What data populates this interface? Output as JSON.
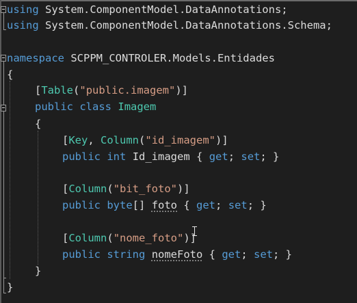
{
  "code": {
    "lines": [
      {
        "k1": "using",
        "rest": " System.ComponentModel.DataAnnotations;"
      },
      {
        "k1": "using",
        "rest": " System.ComponentModel.DataAnnotations.Schema;"
      },
      {
        "k1": "namespace",
        "rest": " SCPPM_CONTROLER.Models.Entidades"
      },
      {
        "brace": "{"
      },
      {
        "attr_open": "[",
        "attr_name": "Table",
        "paren_open": "(",
        "str": "\"public.imagem\"",
        "paren_close": ")]"
      },
      {
        "kw1": "public",
        "kw2": "class",
        "type": "Imagem"
      },
      {
        "brace": "{"
      },
      {
        "attr_open": "[",
        "attr_name": "Key",
        "sep": ", ",
        "attr_name2": "Column",
        "paren_open": "(",
        "str": "\"id_imagem\"",
        "paren_close": ")]"
      },
      {
        "kw1": "public",
        "kw2": "int",
        "name": "Id_imagem",
        "acc_open": " { ",
        "get": "get",
        "semi1": "; ",
        "set": "set",
        "acc_close": "; }"
      },
      {
        "attr_open": "[",
        "attr_name": "Column",
        "paren_open": "(",
        "str": "\"bit_foto\"",
        "paren_close": ")]"
      },
      {
        "kw1": "public",
        "kw2": "byte",
        "arr": "[]",
        "name": "foto",
        "acc_open": " { ",
        "get": "get",
        "semi1": "; ",
        "set": "set",
        "acc_close": "; }"
      },
      {
        "attr_open": "[",
        "attr_name": "Column",
        "paren_open": "(",
        "str": "\"nome_foto\"",
        "paren_close": ")]"
      },
      {
        "kw1": "public",
        "kw2": "string",
        "name": "nomeFoto",
        "acc_open": " { ",
        "get": "get",
        "semi1": "; ",
        "set": "set",
        "acc_close": "; }"
      },
      {
        "brace": "}"
      },
      {
        "brace": "}"
      }
    ]
  },
  "colors": {
    "background": "#1e1e1e",
    "keyword": "#569cd6",
    "type": "#4ec9b0",
    "string": "#d69d85",
    "text": "#dcdcdc"
  },
  "icons": {
    "fold_markers": "collapse-minus-icon",
    "cursor": "text-ibeam-cursor-icon"
  }
}
